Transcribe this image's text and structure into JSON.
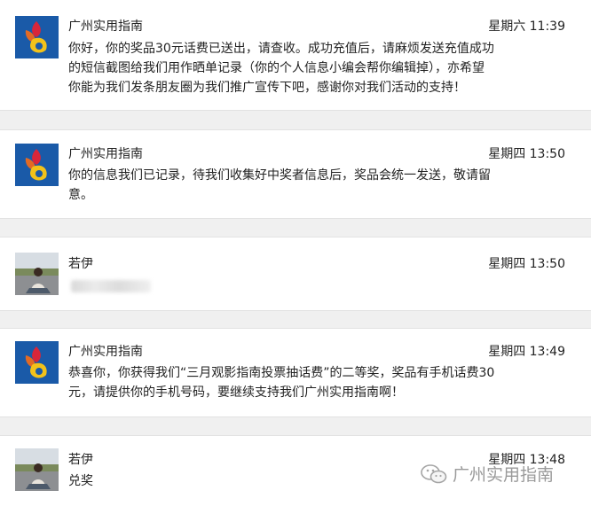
{
  "messages": [
    {
      "sender": "广州实用指南",
      "time": "星期六 11:39",
      "avatar": "logo-avatar",
      "text": "你好，你的奖品30元话费已送出，请查收。成功充值后，请麻烦发送充值成功的短信截图给我们用作晒单记录（你的个人信息小编会帮你编辑掉），亦希望你能为我们发条朋友圈为我们推广宣传下吧，感谢你对我们活动的支持！"
    },
    {
      "sender": "广州实用指南",
      "time": "星期四 13:50",
      "avatar": "logo-avatar",
      "text": "你的信息我们已记录，待我们收集好中奖者信息后，奖品会统一发送，敬请留意。"
    },
    {
      "sender": "若伊",
      "time": "星期四 13:50",
      "avatar": "photo-avatar",
      "text": ""
    },
    {
      "sender": "广州实用指南",
      "time": "星期四 13:49",
      "avatar": "logo-avatar",
      "text": "恭喜你，你获得我们“三月观影指南投票抽话费”的二等奖，奖品有手机话费30元，请提供你的手机号码，要继续支持我们广州实用指南啊！"
    },
    {
      "sender": "若伊",
      "time": "星期四 13:48",
      "avatar": "photo-avatar",
      "text": "兑奖"
    }
  ],
  "watermark": {
    "text": "广州实用指南",
    "icon": "wechat-icon"
  },
  "colors": {
    "logo_blue": "#1a5aa8",
    "logo_yellow": "#f2c21a",
    "logo_red": "#d8263a"
  }
}
